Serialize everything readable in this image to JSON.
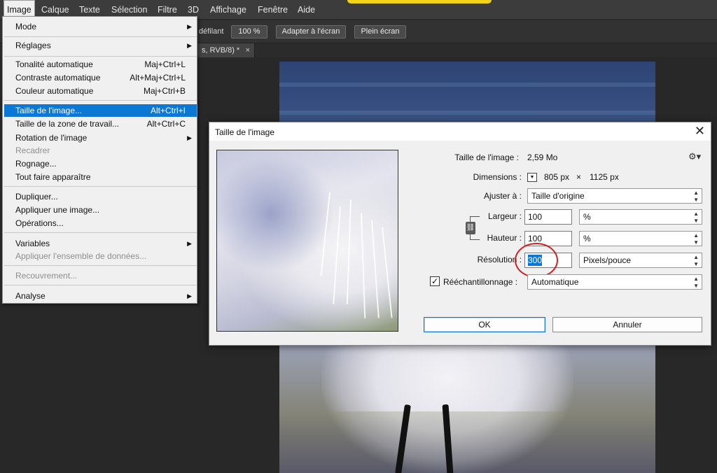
{
  "menubar": {
    "items": [
      "Image",
      "Calque",
      "Texte",
      "Sélection",
      "Filtre",
      "3D",
      "Affichage",
      "Fenêtre",
      "Aide"
    ]
  },
  "options_bar": {
    "scroll_label": "défilant",
    "zoom_button": "100 %",
    "fit_button": "Adapter à l'écran",
    "fullscreen_button": "Plein écran"
  },
  "document_tab": {
    "title": "s, RVB/8) *",
    "close": "×"
  },
  "image_menu": {
    "items": [
      {
        "label": "Mode",
        "shortcut": "",
        "submenu": true,
        "disabled": false
      },
      {
        "label": "Réglages",
        "shortcut": "",
        "submenu": true,
        "disabled": false
      },
      {
        "label": "Tonalité automatique",
        "shortcut": "Maj+Ctrl+L",
        "submenu": false,
        "disabled": false
      },
      {
        "label": "Contraste automatique",
        "shortcut": "Alt+Maj+Ctrl+L",
        "submenu": false,
        "disabled": false
      },
      {
        "label": "Couleur automatique",
        "shortcut": "Maj+Ctrl+B",
        "submenu": false,
        "disabled": false
      },
      {
        "label": "Taille de l'image...",
        "shortcut": "Alt+Ctrl+I",
        "submenu": false,
        "disabled": false,
        "selected": true
      },
      {
        "label": "Taille de la zone de travail...",
        "shortcut": "Alt+Ctrl+C",
        "submenu": false,
        "disabled": false
      },
      {
        "label": "Rotation de l'image",
        "shortcut": "",
        "submenu": true,
        "disabled": false
      },
      {
        "label": "Recadrer",
        "shortcut": "",
        "submenu": false,
        "disabled": true
      },
      {
        "label": "Rognage...",
        "shortcut": "",
        "submenu": false,
        "disabled": false
      },
      {
        "label": "Tout faire apparaître",
        "shortcut": "",
        "submenu": false,
        "disabled": false
      },
      {
        "label": "Dupliquer...",
        "shortcut": "",
        "submenu": false,
        "disabled": false
      },
      {
        "label": "Appliquer une image...",
        "shortcut": "",
        "submenu": false,
        "disabled": false
      },
      {
        "label": "Opérations...",
        "shortcut": "",
        "submenu": false,
        "disabled": false
      },
      {
        "label": "Variables",
        "shortcut": "",
        "submenu": true,
        "disabled": false
      },
      {
        "label": "Appliquer l'ensemble de données...",
        "shortcut": "",
        "submenu": false,
        "disabled": true
      },
      {
        "label": "Recouvrement...",
        "shortcut": "",
        "submenu": false,
        "disabled": true
      },
      {
        "label": "Analyse",
        "shortcut": "",
        "submenu": true,
        "disabled": false
      }
    ]
  },
  "dialog": {
    "title": "Taille de l'image",
    "close": "✕",
    "image_size_label": "Taille de l'image :",
    "image_size_value": "2,59 Mo",
    "dimensions_label": "Dimensions :",
    "dimensions_width": "805 px",
    "dimensions_times": "×",
    "dimensions_height": "1125 px",
    "fit_label": "Ajuster à :",
    "fit_value": "Taille d'origine",
    "width_label": "Largeur :",
    "width_value": "100",
    "width_unit": "%",
    "height_label": "Hauteur :",
    "height_value": "100",
    "height_unit": "%",
    "resolution_label": "Résolution :",
    "resolution_value": "300",
    "resolution_unit": "Pixels/pouce",
    "resample_label": "Rééchantillonnage :",
    "resample_checked": "✓",
    "resample_value": "Automatique",
    "ok_button": "OK",
    "cancel_button": "Annuler",
    "highlight_color": "#d62020",
    "selection_color": "#0b78d6"
  }
}
